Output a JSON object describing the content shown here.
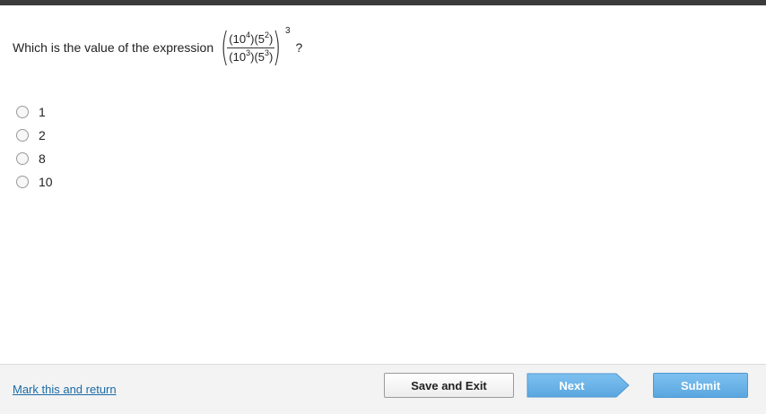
{
  "question": {
    "prompt": "Which is the value of the expression",
    "expression": {
      "num_base_1": "(10",
      "num_exp_1": "4",
      "num_mid": ")(5",
      "num_exp_2": "2",
      "num_end": ")",
      "den_base_1": "(10",
      "den_exp_1": "3",
      "den_mid": ")(5",
      "den_exp_2": "3",
      "den_end": ")",
      "outer_exponent": "3"
    },
    "suffix": "?"
  },
  "options": [
    {
      "label": "1",
      "selected": false
    },
    {
      "label": "2",
      "selected": false
    },
    {
      "label": "8",
      "selected": false
    },
    {
      "label": "10",
      "selected": false
    }
  ],
  "footer": {
    "mark_link": "Mark this and return",
    "save_exit": "Save and Exit",
    "next": "Next",
    "submit": "Submit"
  },
  "colors": {
    "top_bar": "#3c3c3c",
    "link": "#1a6aa6",
    "primary_button": "#6cb4ea"
  }
}
